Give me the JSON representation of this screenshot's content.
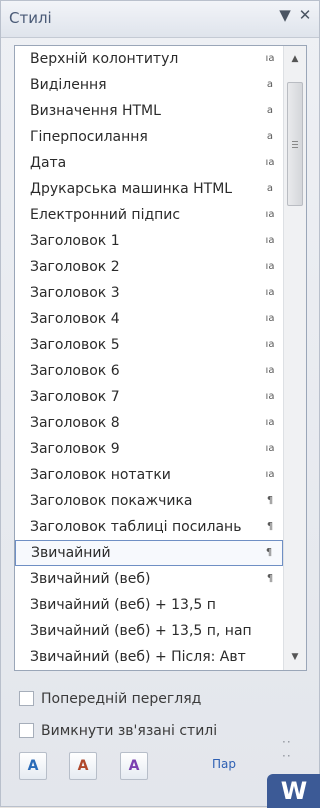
{
  "pane": {
    "title": "Стилі",
    "dropdown_glyph": "▼",
    "close_glyph": "✕"
  },
  "styles_list": {
    "items": [
      {
        "label": "Верхній колонтитул",
        "mark": "ıа"
      },
      {
        "label": "Виділення",
        "mark": "a"
      },
      {
        "label": "Визначення HTML",
        "mark": "a"
      },
      {
        "label": "Гіперпосилання",
        "mark": "a"
      },
      {
        "label": "Дата",
        "mark": "ıа"
      },
      {
        "label": "Друкарська машинка HTML",
        "mark": "a"
      },
      {
        "label": "Електронний підпис",
        "mark": "ıа"
      },
      {
        "label": "Заголовок 1",
        "mark": "ıа"
      },
      {
        "label": "Заголовок 2",
        "mark": "ıа"
      },
      {
        "label": "Заголовок 3",
        "mark": "ıа"
      },
      {
        "label": "Заголовок 4",
        "mark": "ıа"
      },
      {
        "label": "Заголовок 5",
        "mark": "ıа"
      },
      {
        "label": "Заголовок 6",
        "mark": "ıа"
      },
      {
        "label": "Заголовок 7",
        "mark": "ıа"
      },
      {
        "label": "Заголовок 8",
        "mark": "ıа"
      },
      {
        "label": "Заголовок 9",
        "mark": "ıа"
      },
      {
        "label": "Заголовок нотатки",
        "mark": "ıа"
      },
      {
        "label": "Заголовок покажчика",
        "mark": "¶"
      },
      {
        "label": "Заголовок таблиці посилань",
        "mark": "¶"
      },
      {
        "label": "Звичайний",
        "mark": "¶",
        "selected": true
      },
      {
        "label": "Звичайний (веб)",
        "mark": "¶"
      },
      {
        "label": "Звичайний (веб) + 13,5 п",
        "mark": ""
      },
      {
        "label": "Звичайний (веб) + 13,5 п, нап",
        "mark": ""
      },
      {
        "label": "Звичайний (веб) + Після:  Авт",
        "mark": ""
      }
    ]
  },
  "options": {
    "preview_label": "Попередній перегляд",
    "linked_styles_label": "Вимкнути зв'язані стилі"
  },
  "toolbar": {
    "new_style_icon": "new-style-icon",
    "style_inspector_icon": "style-inspector-icon",
    "manage_styles_icon": "manage-styles-icon",
    "parameters_link": "Пар",
    "corner_logo_letter": "W"
  }
}
